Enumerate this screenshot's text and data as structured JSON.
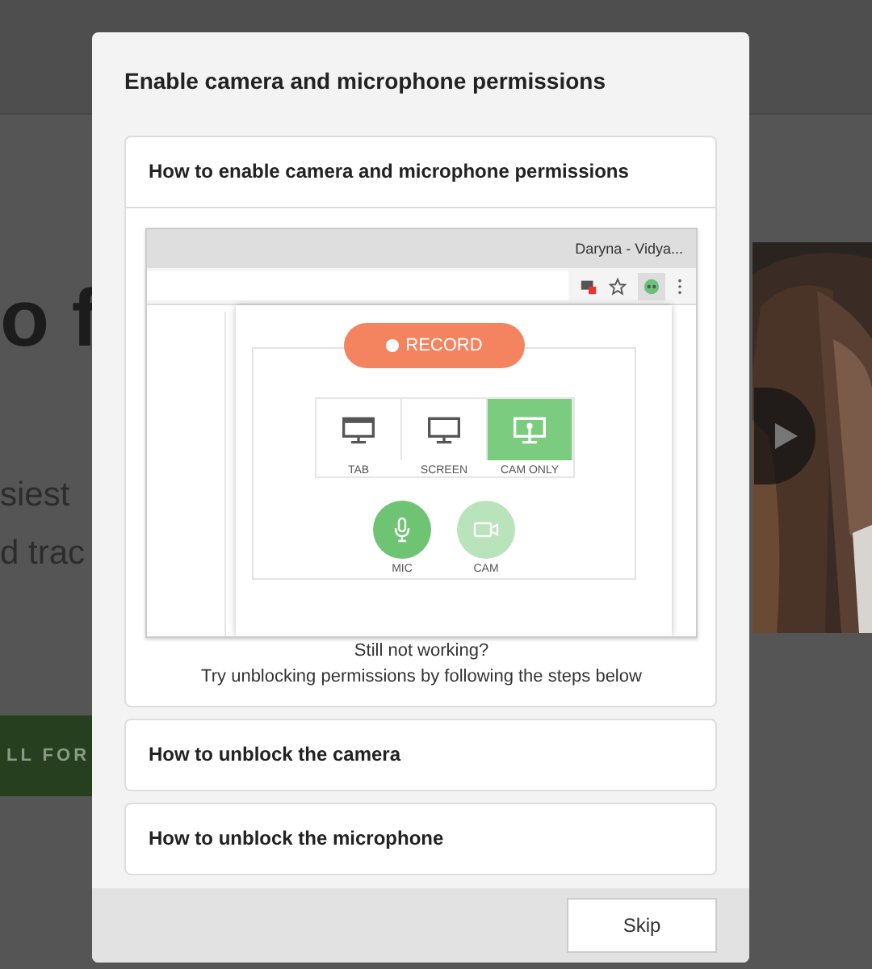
{
  "background": {
    "heading": "o f",
    "lines": [
      "siest",
      "d trac"
    ],
    "button": "LL FOR",
    "video": {
      "kind": "picture"
    }
  },
  "dialog": {
    "title": "Enable camera and microphone permissions",
    "sections": [
      {
        "title": "How to enable camera and microphone permissions",
        "expanded": true,
        "screenshot": {
          "window_title": "Daryna - Vidya...",
          "record_button": "RECORD",
          "modes": [
            {
              "label": "TAB",
              "kind": "tab",
              "selected": false
            },
            {
              "label": "SCREEN",
              "kind": "screen",
              "selected": false
            },
            {
              "label": "CAM ONLY",
              "kind": "cam",
              "selected": true
            }
          ],
          "toggles": [
            {
              "label": "MIC",
              "kind": "mic",
              "on": true
            },
            {
              "label": "CAM",
              "kind": "cam",
              "on": false
            }
          ]
        },
        "help_lines": [
          "Still not working?",
          "Try unblocking permissions by following the steps below"
        ]
      },
      {
        "title": "How to unblock the camera",
        "expanded": false
      },
      {
        "title": "How to unblock the microphone",
        "expanded": false
      }
    ],
    "buttons": [
      "Skip"
    ]
  }
}
